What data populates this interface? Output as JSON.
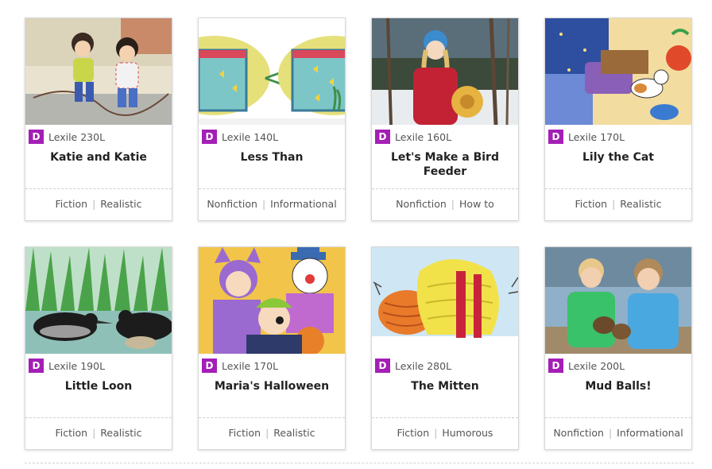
{
  "colors": {
    "level_badge": "#a31fb6"
  },
  "cards": [
    {
      "level": "D",
      "lexile": "Lexile 230L",
      "title": "Katie and Katie",
      "tags": [
        "Fiction",
        "Realistic"
      ],
      "image": "two-girls-jump-rope-illustration"
    },
    {
      "level": "D",
      "lexile": "Lexile 140L",
      "title": "Less Than",
      "tags": [
        "Nonfiction",
        "Informational"
      ],
      "image": "fish-tanks-less-than-illustration"
    },
    {
      "level": "D",
      "lexile": "Lexile 160L",
      "title": "Let's Make a Bird Feeder",
      "tags": [
        "Nonfiction",
        "How to"
      ],
      "image": "girl-with-bird-feeder-photo"
    },
    {
      "level": "D",
      "lexile": "Lexile 170L",
      "title": "Lily the Cat",
      "tags": [
        "Fiction",
        "Realistic"
      ],
      "image": "cat-in-bedroom-illustration"
    },
    {
      "level": "D",
      "lexile": "Lexile 190L",
      "title": "Little Loon",
      "tags": [
        "Fiction",
        "Realistic"
      ],
      "image": "loons-on-lake-illustration"
    },
    {
      "level": "D",
      "lexile": "Lexile 170L",
      "title": "Maria's Halloween",
      "tags": [
        "Fiction",
        "Realistic"
      ],
      "image": "kids-in-costumes-illustration"
    },
    {
      "level": "D",
      "lexile": "Lexile 280L",
      "title": "The Mitten",
      "tags": [
        "Fiction",
        "Humorous"
      ],
      "image": "mitten-in-snow-illustration"
    },
    {
      "level": "D",
      "lexile": "Lexile 200L",
      "title": "Mud Balls!",
      "tags": [
        "Nonfiction",
        "Informational"
      ],
      "image": "kids-with-mud-balls-photo"
    }
  ]
}
